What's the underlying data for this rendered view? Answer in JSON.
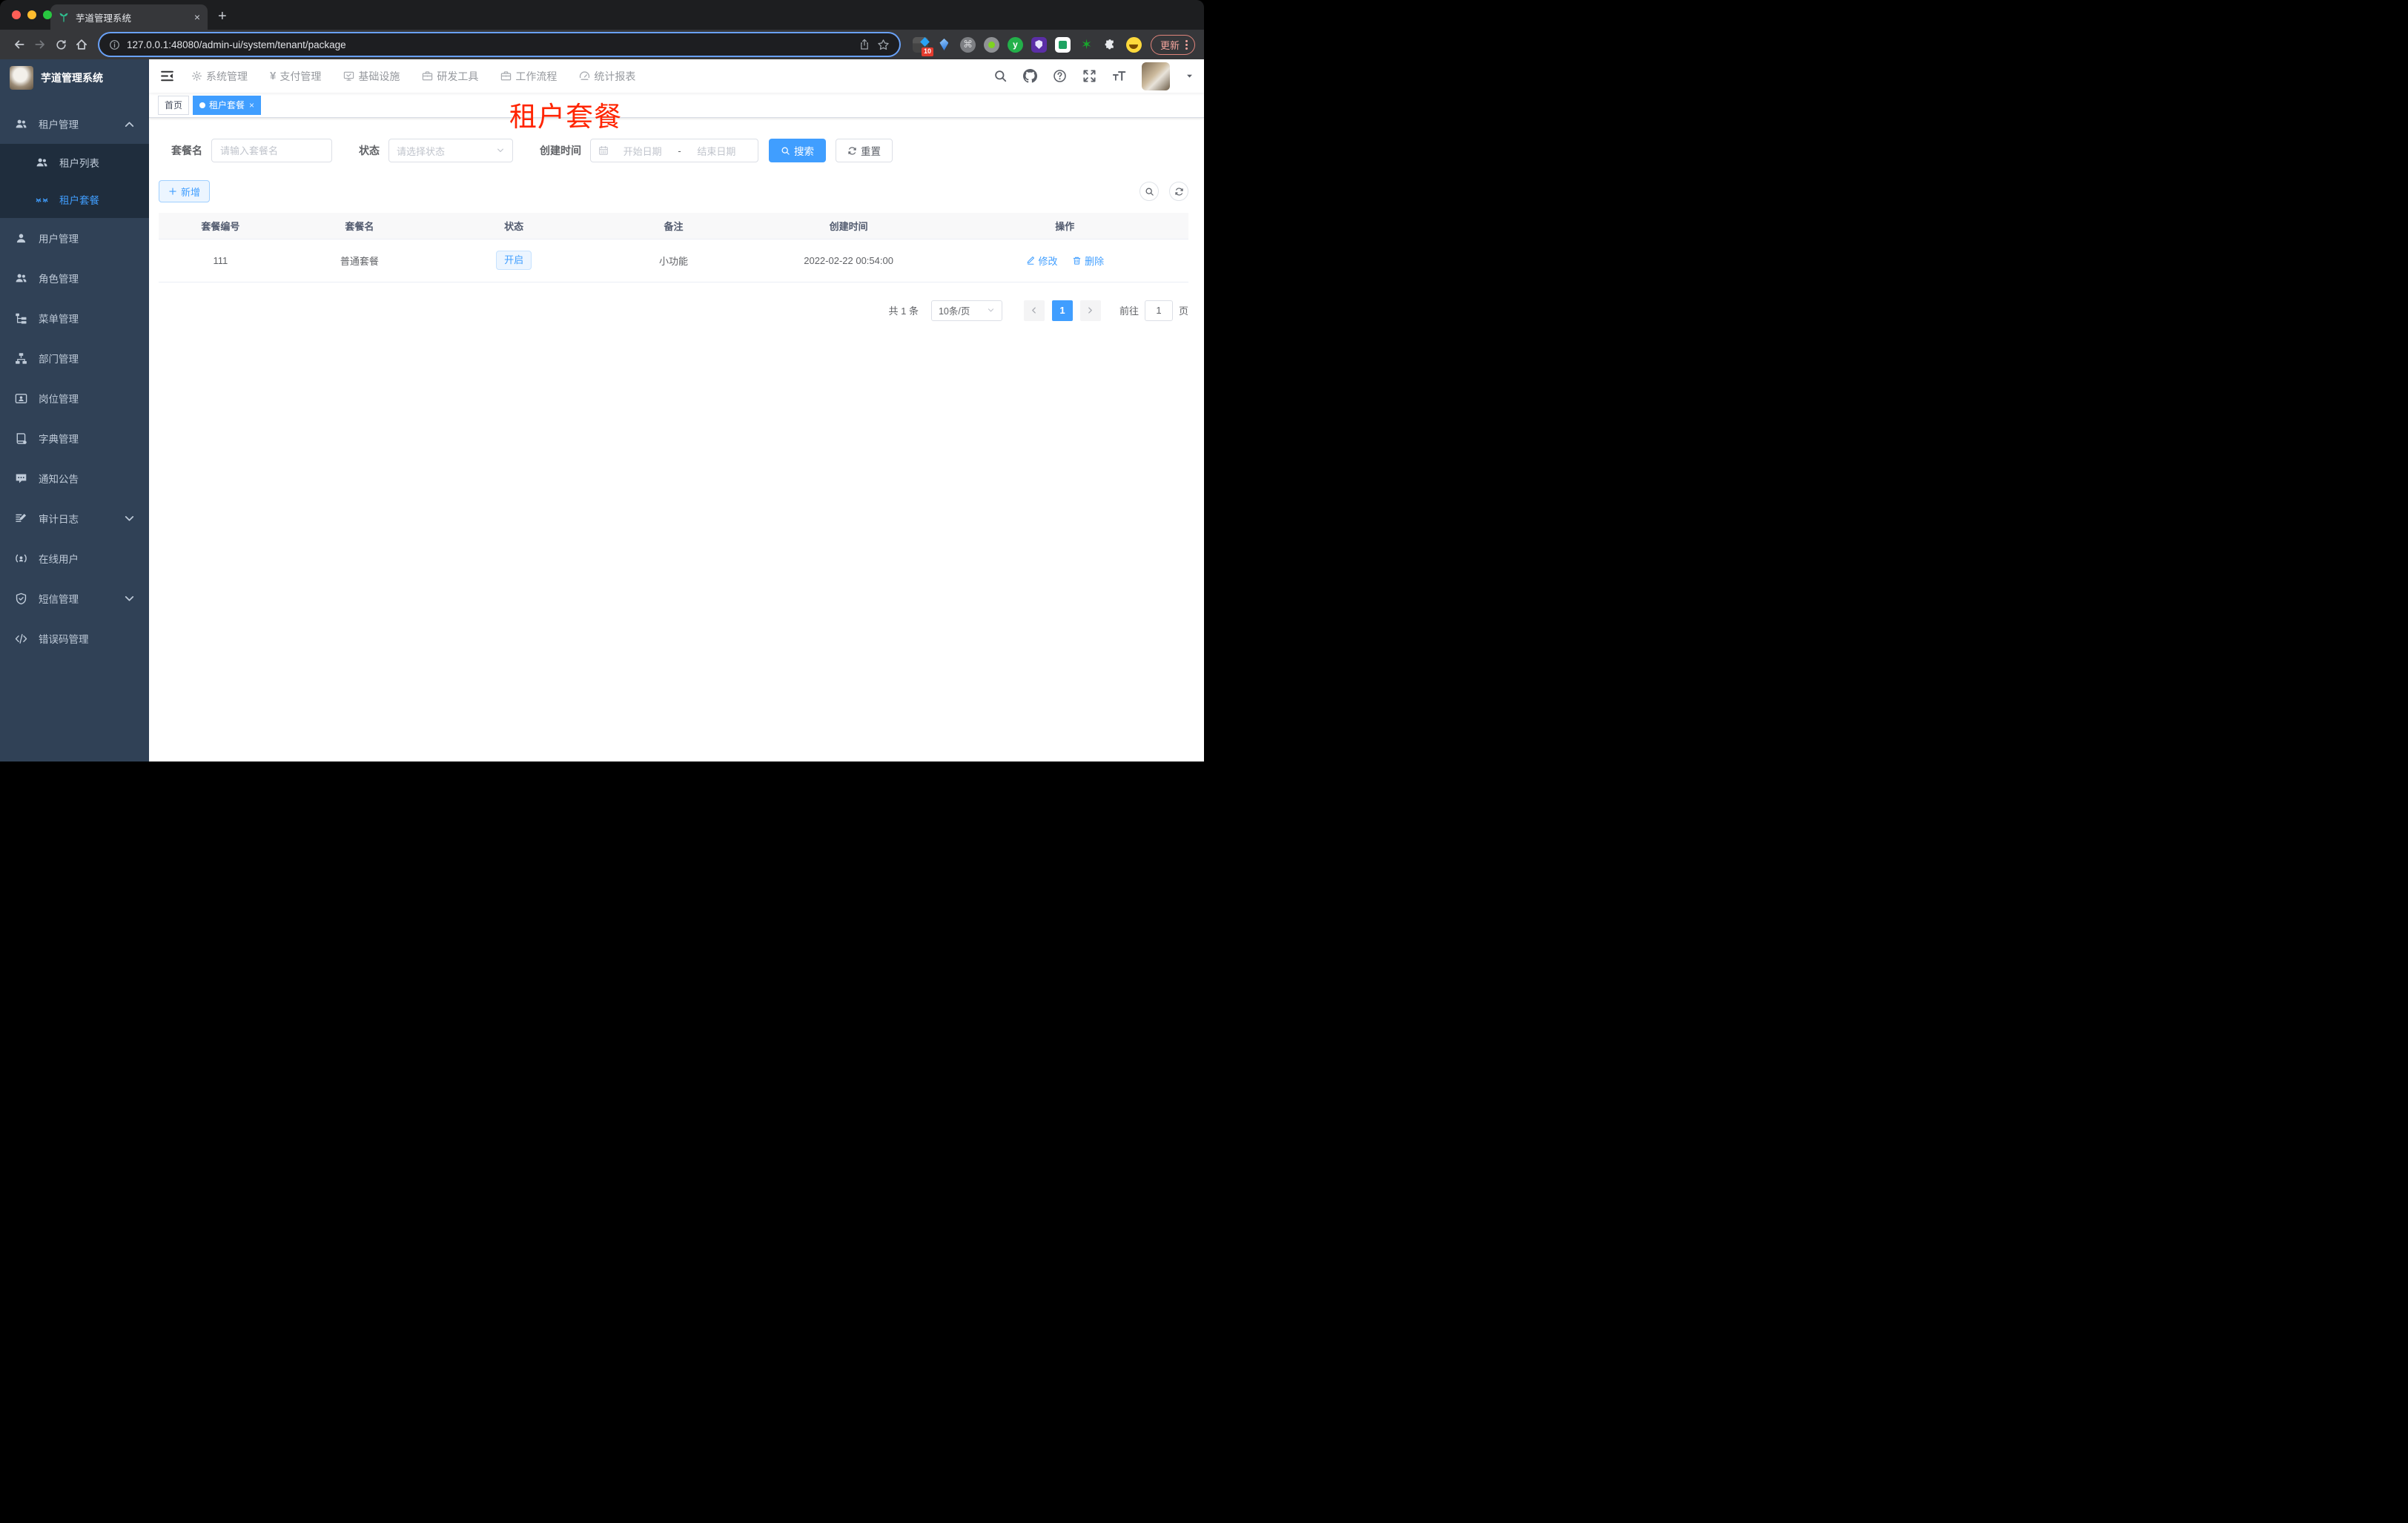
{
  "colors": {
    "accent": "#409eff",
    "sidebar_bg": "#304156",
    "submenu_bg": "#1f2d3d",
    "sidebar_text": "#bfcbd9",
    "overlay_title_red": "#ff2400",
    "status_tag_bg": "#ecf5ff",
    "chrome_dark": "#36373a",
    "update_pill": "#f3a59d"
  },
  "browser": {
    "tab": {
      "title": "芋道管理系统",
      "close": "×"
    },
    "new_tab_label": "+",
    "url": "127.0.0.1:48080/admin-ui/system/tenant/package",
    "extension_badge": "10",
    "update_label": "更新",
    "icons": {
      "cmd_glyph": "⌘",
      "y_glyph": "y",
      "star_glyph": "✶"
    }
  },
  "header": {
    "nav": [
      {
        "label": "系统管理"
      },
      {
        "label": "支付管理"
      },
      {
        "label": "基础设施"
      },
      {
        "label": "研发工具"
      },
      {
        "label": "工作流程"
      },
      {
        "label": "统计报表"
      }
    ]
  },
  "sidebar": {
    "title": "芋道管理系统",
    "items": [
      {
        "label": "租户管理"
      },
      {
        "label": "租户列表"
      },
      {
        "label": "租户套餐"
      },
      {
        "label": "用户管理"
      },
      {
        "label": "角色管理"
      },
      {
        "label": "菜单管理"
      },
      {
        "label": "部门管理"
      },
      {
        "label": "岗位管理"
      },
      {
        "label": "字典管理"
      },
      {
        "label": "通知公告"
      },
      {
        "label": "审计日志"
      },
      {
        "label": "在线用户"
      },
      {
        "label": "短信管理"
      },
      {
        "label": "错误码管理"
      }
    ]
  },
  "tags": {
    "home": "首页",
    "active": "租户套餐",
    "close": "×"
  },
  "overlay_title": "租户套餐",
  "filters": {
    "name_label": "套餐名",
    "name_placeholder": "请输入套餐名",
    "status_label": "状态",
    "status_placeholder": "请选择状态",
    "created_label": "创建时间",
    "start_placeholder": "开始日期",
    "range_separator": "-",
    "end_placeholder": "结束日期",
    "search_label": "搜索",
    "reset_label": "重置"
  },
  "toolbar": {
    "add_label": "新增"
  },
  "table": {
    "columns": [
      "套餐编号",
      "套餐名",
      "状态",
      "备注",
      "创建时间",
      "操作"
    ],
    "rows": [
      {
        "id": "111",
        "name": "普通套餐",
        "status": "开启",
        "remark": "小功能",
        "created": "2022-02-22 00:54:00",
        "edit_label": "修改",
        "delete_label": "删除"
      }
    ]
  },
  "pagination": {
    "total": "共 1 条",
    "page_size": "10条/页",
    "current_page": "1",
    "goto_label": "前往",
    "goto_value": "1",
    "page_unit": "页"
  }
}
